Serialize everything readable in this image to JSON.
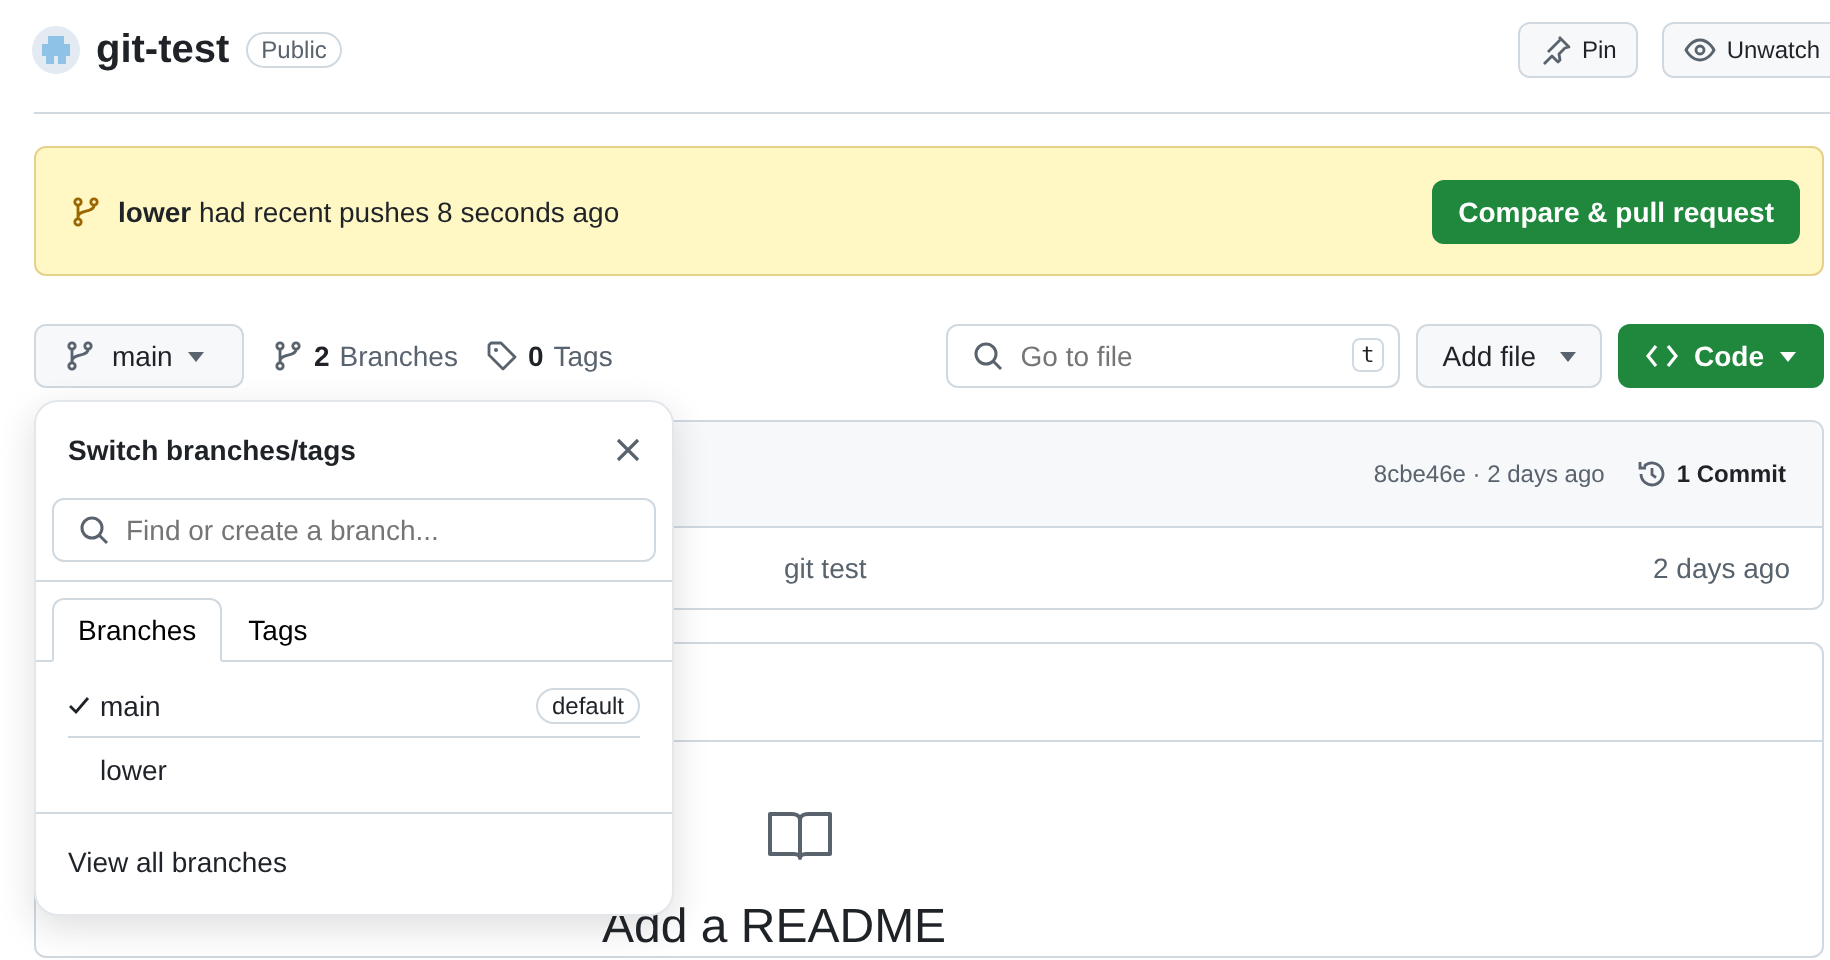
{
  "repo": {
    "name": "git-test",
    "visibility": "Public"
  },
  "header_buttons": [
    {
      "kind": "pin",
      "label": "Pin"
    },
    {
      "kind": "watch",
      "label": "Unwatch"
    }
  ],
  "banner": {
    "text": "**lower** had recent pushes 8 seconds ago",
    "button": "Compare & pull request"
  },
  "toolbar": {
    "branch": "main",
    "branches": "2",
    "branches_label": "Branches",
    "tags": "0",
    "tags_label": "Tags",
    "search_placeholder": "Go to file",
    "search_key": "t",
    "add_file": "Add file",
    "code": "Code"
  },
  "commit_bar": {
    "meta": "8cbe46e · 2 days ago",
    "commits": "1 Commit"
  },
  "files": [
    {
      "message": "git test",
      "time": "2 days ago"
    }
  ],
  "readme": {
    "title": "Add a README"
  },
  "branch_menu": {
    "title": "Switch branches/tags",
    "placeholder": "Find or create a branch...",
    "tabs": [
      {
        "label": "Branches",
        "selected": true
      },
      {
        "label": "Tags",
        "selected": false
      }
    ],
    "items": [
      {
        "name": "main",
        "checked": true,
        "badge": "default"
      },
      {
        "name": "lower",
        "checked": false
      }
    ],
    "footer": "View all branches"
  }
}
